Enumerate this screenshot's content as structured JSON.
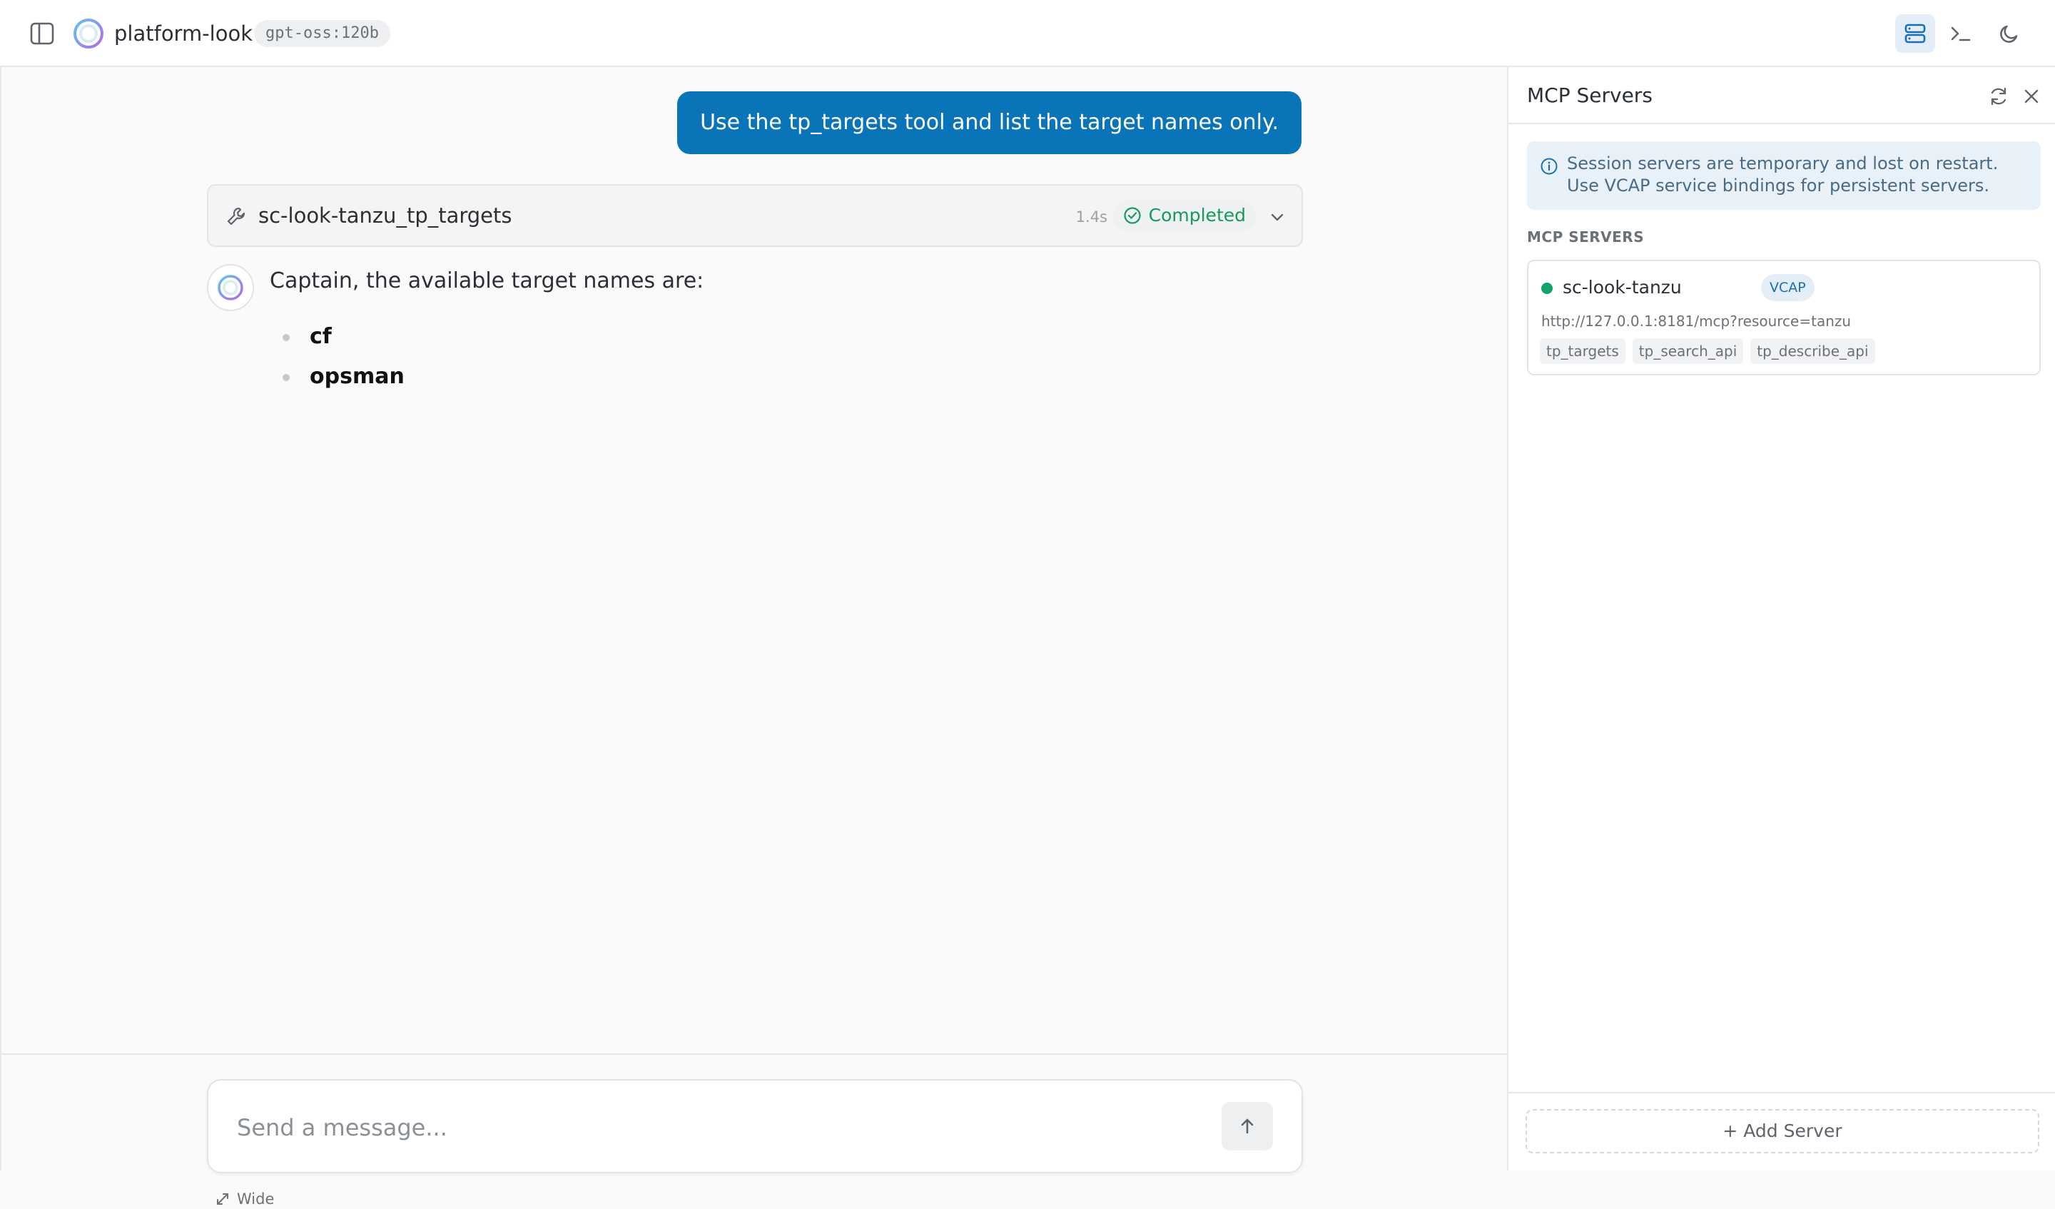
{
  "header": {
    "app_title": "platform-look",
    "model_badge": "gpt-oss:120b",
    "icons": [
      "sidebar-toggle-icon",
      "servers-icon",
      "terminal-icon",
      "moon-icon"
    ]
  },
  "chat": {
    "user_message": "Use the tp_targets tool and list the target names only.",
    "tool_call": {
      "name": "sc-look-tanzu_tp_targets",
      "duration": "1.4s",
      "status": "Completed"
    },
    "assistant": {
      "intro": "Captain, the available target names are:",
      "items": [
        "cf",
        "opsman"
      ]
    }
  },
  "composer": {
    "placeholder": "Send a message...",
    "wide_label": "Wide"
  },
  "panel": {
    "title": "MCP Servers",
    "info": "Session servers are temporary and lost on restart. Use VCAP service bindings for persistent servers.",
    "section_label": "MCP SERVERS",
    "servers": [
      {
        "name": "sc-look-tanzu",
        "badge": "VCAP",
        "url": "http://127.0.0.1:8181/mcp?resource=tanzu",
        "tools": [
          "tp_targets",
          "tp_search_api",
          "tp_describe_api"
        ],
        "status_color": "#16a36a"
      }
    ],
    "add_button": "+ Add Server"
  },
  "colors": {
    "accent": "#0a74b8",
    "success": "#1a9860"
  }
}
